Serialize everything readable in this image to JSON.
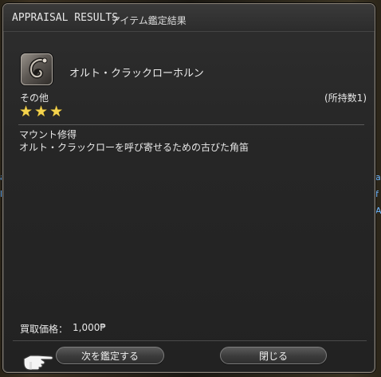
{
  "window": {
    "title": "APPRAISAL RESULTS",
    "subtitle": "アイテム鑑定結果"
  },
  "item": {
    "icon": "horn-icon",
    "name": "オルト・クラックローホルン",
    "category": "その他",
    "owned": "(所持数1)",
    "stars": [
      "★",
      "★",
      "★"
    ],
    "description_title": "マウント修得",
    "description_body": "オルト・クラックローを呼び寄せるための古びた角笛",
    "price_label": "買取価格：",
    "price_value": "1,000",
    "currency_symbol": "₱"
  },
  "buttons": {
    "appraise_next": "次を鑑定する",
    "close": "閉じる"
  },
  "background": {
    "left_fragments": [
      "a",
      "F"
    ],
    "right_fragments": [
      "a",
      "f",
      "A"
    ]
  },
  "colors": {
    "star": "#f4d34d",
    "frame": "#8a8276",
    "panel": "#262626"
  }
}
